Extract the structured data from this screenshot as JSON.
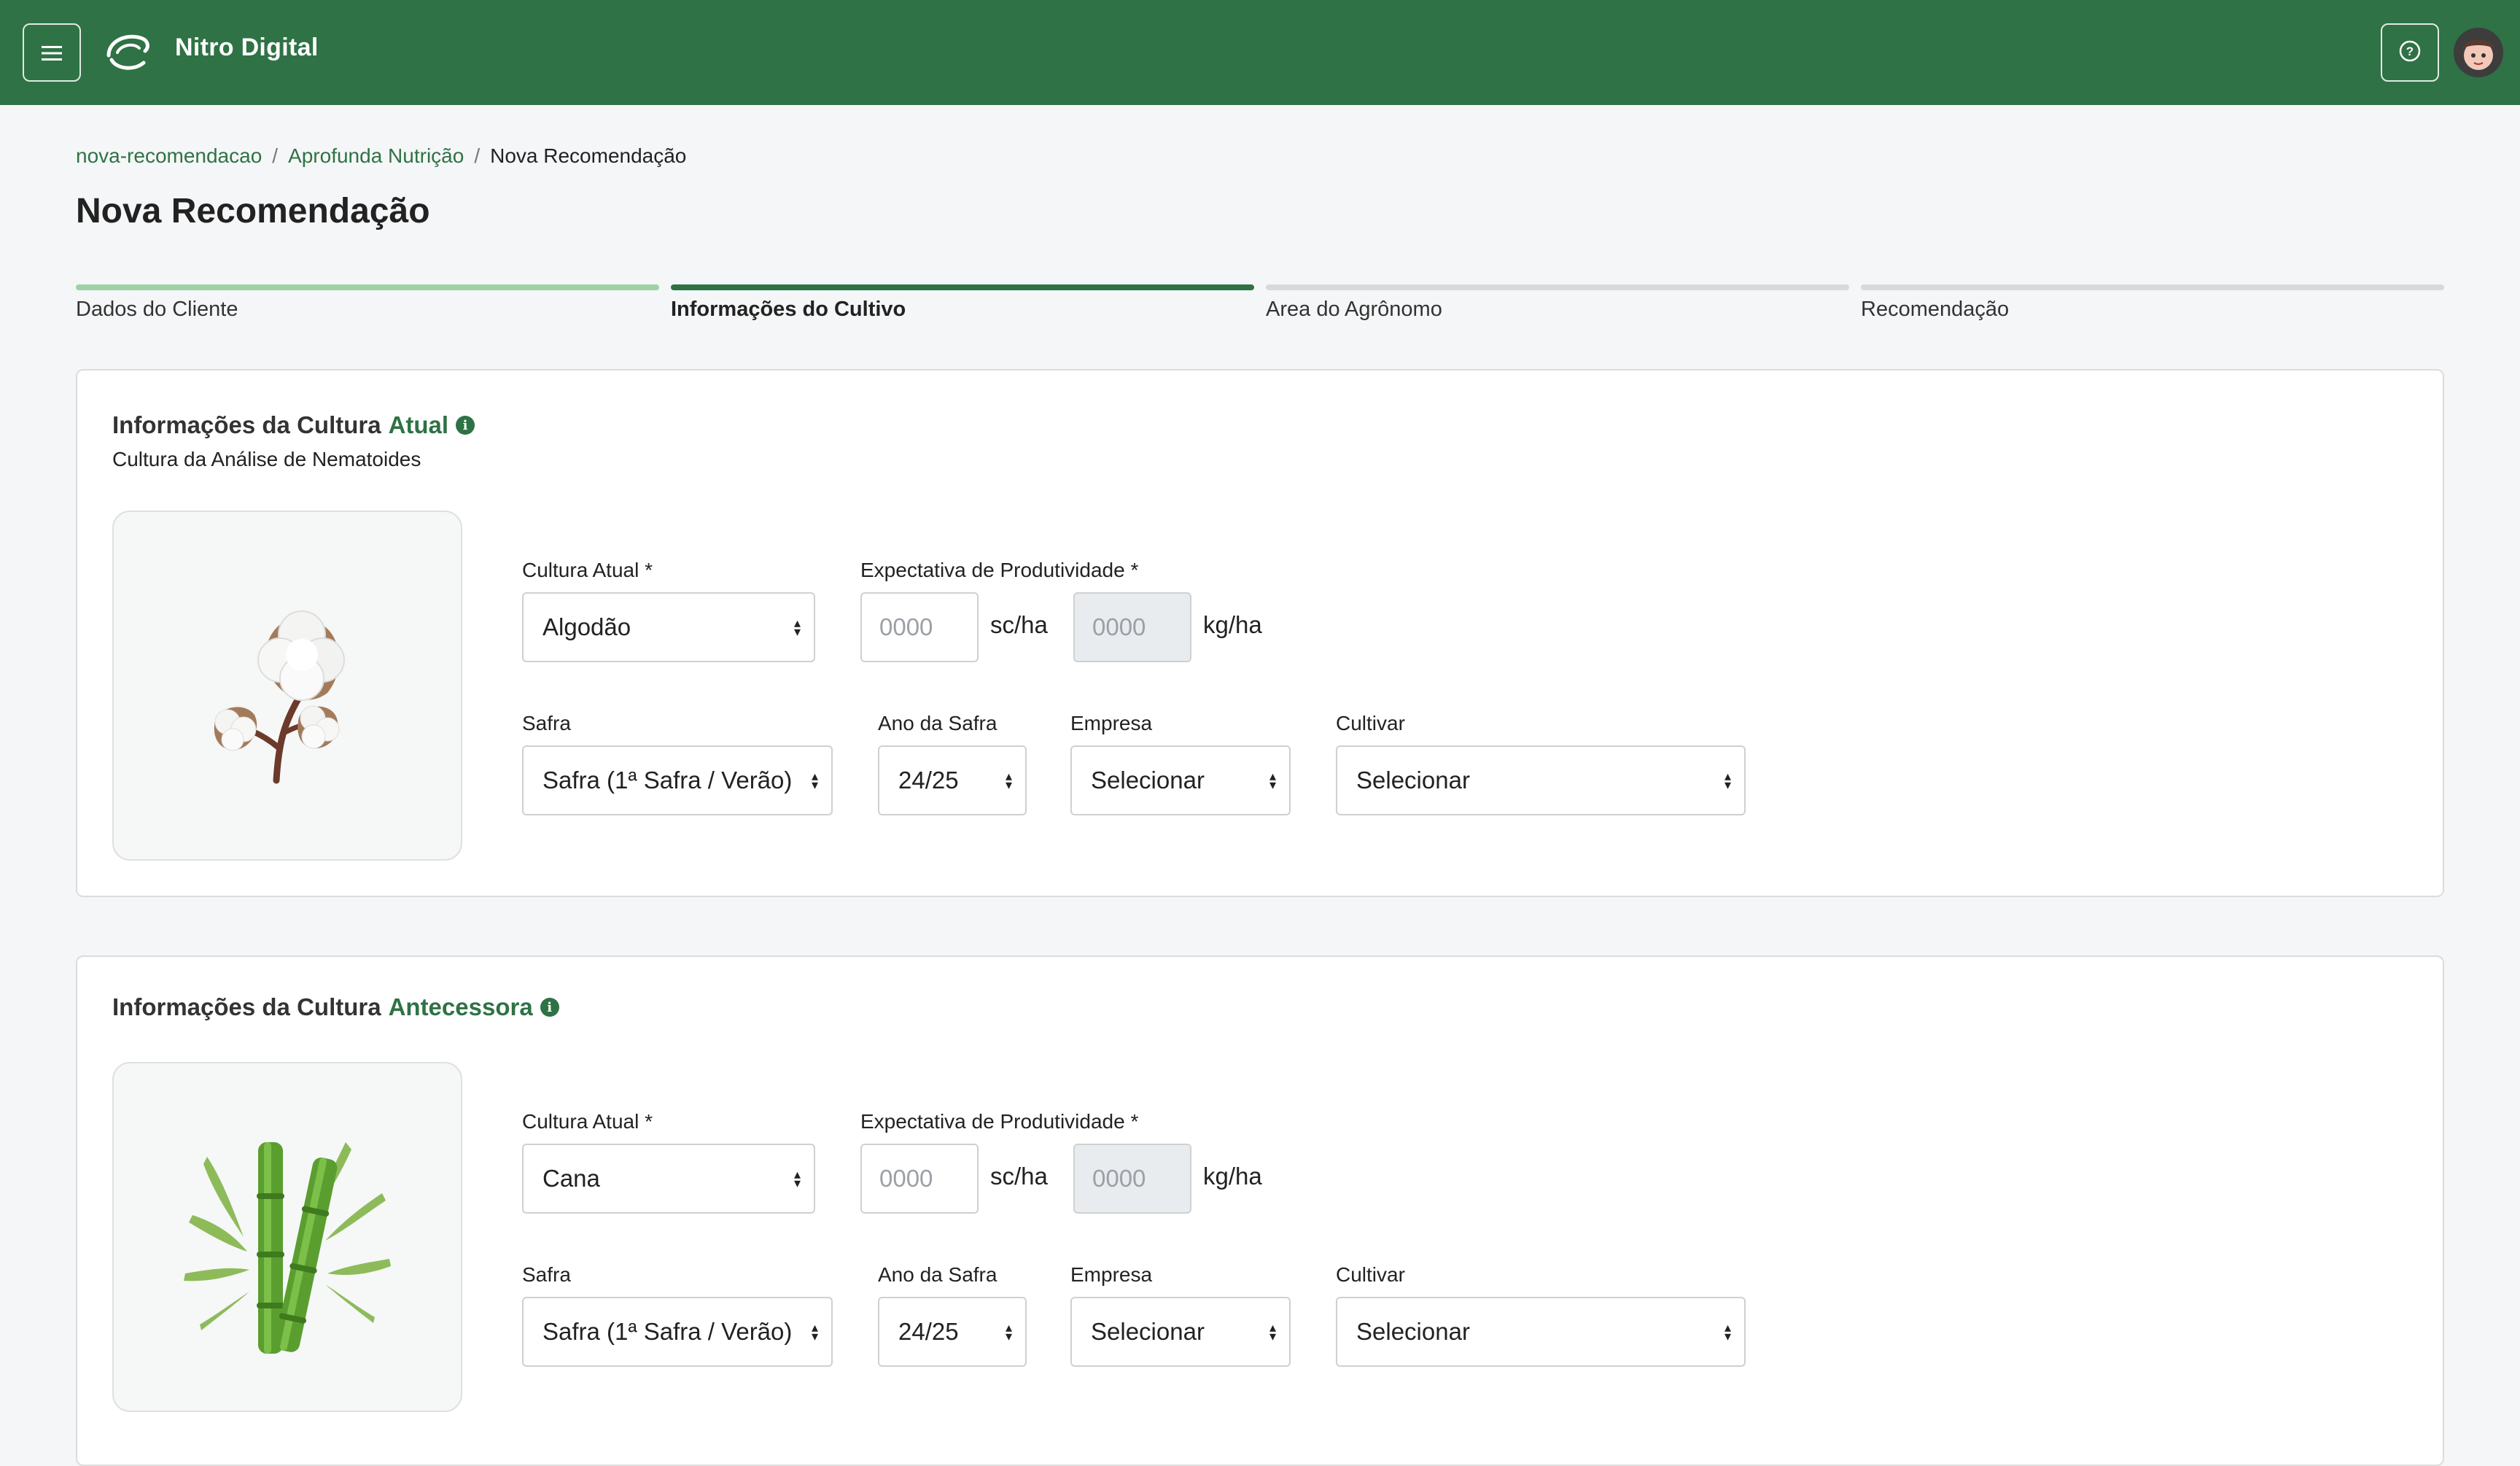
{
  "header": {
    "brand": "Nitro Digital",
    "menu_icon": "hamburger-icon",
    "help_icon": "help-circle-icon",
    "avatar_icon": "user-avatar"
  },
  "breadcrumb": [
    "nova-recomendacao",
    "Aprofunda Nutrição",
    "Nova Recomendação"
  ],
  "page_title": "Nova Recomendação",
  "steps": [
    {
      "label": "Dados do Cliente",
      "state": "done"
    },
    {
      "label": "Informações do Cultivo",
      "state": "active"
    },
    {
      "label": "Area do Agrônomo",
      "state": "pending"
    },
    {
      "label": "Recomendação",
      "state": "pending"
    }
  ],
  "current": {
    "title_prefix": "Informações da Cultura",
    "title_accent": "Atual",
    "subtitle": "Cultura da Análise de Nematoides",
    "image_icon": "cotton-plant-image",
    "cultura_label": "Cultura Atual *",
    "cultura_value": "Algodão",
    "expectativa_label": "Expectativa de Produtividade *",
    "sc_placeholder": "0000",
    "sc_unit": "sc/ha",
    "kg_placeholder": "0000",
    "kg_unit": "kg/ha",
    "safra_label": "Safra",
    "safra_value": "Safra (1ª Safra / Verão)",
    "ano_label": "Ano da Safra",
    "ano_value": "24/25",
    "empresa_label": "Empresa",
    "empresa_value": "Selecionar",
    "cultivar_label": "Cultivar",
    "cultivar_value": "Selecionar"
  },
  "previous": {
    "title_prefix": "Informações da Cultura",
    "title_accent": "Antecessora",
    "image_icon": "sugarcane-plant-image",
    "cultura_label": "Cultura Atual *",
    "cultura_value": "Cana",
    "expectativa_label": "Expectativa de Produtividade *",
    "sc_placeholder": "0000",
    "sc_unit": "sc/ha",
    "kg_placeholder": "0000",
    "kg_unit": "kg/ha",
    "safra_label": "Safra",
    "safra_value": "Safra (1ª Safra / Verão)",
    "ano_label": "Ano da Safra",
    "ano_value": "24/25",
    "empresa_label": "Empresa",
    "empresa_value": "Selecionar",
    "cultivar_label": "Cultivar",
    "cultivar_value": "Selecionar"
  },
  "colors": {
    "brand_green": "#2f7245",
    "step_done": "#9fd0a8",
    "step_pending": "#d9d9d9"
  }
}
